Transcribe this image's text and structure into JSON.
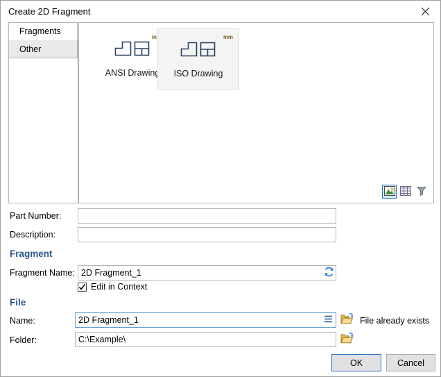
{
  "window": {
    "title": "Create 2D Fragment",
    "close_icon": "close-icon"
  },
  "tabs": [
    {
      "label": "Fragments",
      "active": true
    },
    {
      "label": "Other",
      "active": false
    }
  ],
  "gallery": {
    "items": [
      {
        "label": "ANSI Drawing",
        "unit": "in",
        "selected": false,
        "icon": "drawing-views-icon"
      },
      {
        "label": "ISO Drawing",
        "unit": "mm",
        "selected": true,
        "icon": "drawing-views-icon"
      }
    ],
    "view_modes": [
      {
        "name": "thumbnail-view",
        "active": true
      },
      {
        "name": "list-view",
        "active": false
      },
      {
        "name": "filter",
        "active": false
      }
    ]
  },
  "form": {
    "part_number": {
      "label": "Part Number:",
      "value": "",
      "placeholder": ""
    },
    "description": {
      "label": "Description:",
      "value": "",
      "placeholder": ""
    },
    "fragment_section": "Fragment",
    "fragment_name": {
      "label": "Fragment Name:",
      "value": "2D Fragment_1",
      "refresh_icon": "refresh-icon"
    },
    "edit_in_context": {
      "label": "Edit in Context",
      "checked": true
    },
    "file_section": "File",
    "file_name": {
      "label": "Name:",
      "value": "2D Fragment_1",
      "menu_icon": "list-menu-icon",
      "browse_icon": "open-folder-icon"
    },
    "file_status": "File already exists",
    "folder": {
      "label": "Folder:",
      "value": "C:\\Example\\",
      "browse_icon": "open-folder-icon"
    }
  },
  "buttons": {
    "ok": "OK",
    "cancel": "Cancel"
  },
  "colors": {
    "accent": "#2a72c4",
    "section_heading": "#2a5a8c",
    "icon_line": "#28415e",
    "unit_tag": "#7a5c1e"
  }
}
